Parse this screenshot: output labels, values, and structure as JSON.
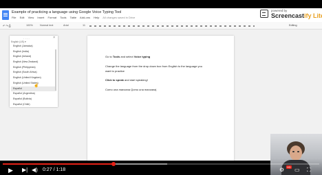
{
  "app": {
    "doc_title": "Example of practicing a language using Google Voice Typing Tool",
    "menu": [
      "File",
      "Edit",
      "View",
      "Insert",
      "Format",
      "Tools",
      "Table",
      "Add-ons",
      "Help"
    ],
    "saved_status": "All changes saved in Drive"
  },
  "branding": {
    "powered_by": "powered by",
    "name_main": "Screencast",
    "name_accent": "ify Lite"
  },
  "toolbar": {
    "zoom": "100%",
    "style": "Normal text",
    "font": "Arial",
    "size": "11",
    "mode": "Editing"
  },
  "voice_panel": {
    "close_label": "×",
    "dots": "· · · ·",
    "select_label": "English (US) ▾",
    "languages": [
      "English (Jamaica)",
      "English (India)",
      "English (Ireland)",
      "English (New Zealand)",
      "English (Philippines)",
      "English (South Africa)",
      "English (United Kingdom)",
      "English (United States)",
      "Español",
      "Español (Argentina)",
      "Español (Bolivia)",
      "Español (Chile)"
    ],
    "highlighted_index": 8
  },
  "document": {
    "p1_pre": "Go to ",
    "p1_tools": "Tools",
    "p1_mid": " and select ",
    "p1_voice": "Voice typing",
    "p2": "Change the language from the drop down box from English to the language you want to practice",
    "p3_click": "Click to speak",
    "p3_rest": " and start speaking!",
    "p4": "Como una manzana Qomo una manzana|"
  },
  "player": {
    "current_time": "0:27",
    "separator": " / ",
    "duration": "1:18",
    "progress_fraction": 0.35,
    "loaded_fraction": 0.52,
    "hd_badge": "HD",
    "play_icon": "play-icon",
    "colors": {
      "progress": "#e62117",
      "docs_blue": "#4285f4",
      "brand_accent": "#e8a020"
    }
  }
}
